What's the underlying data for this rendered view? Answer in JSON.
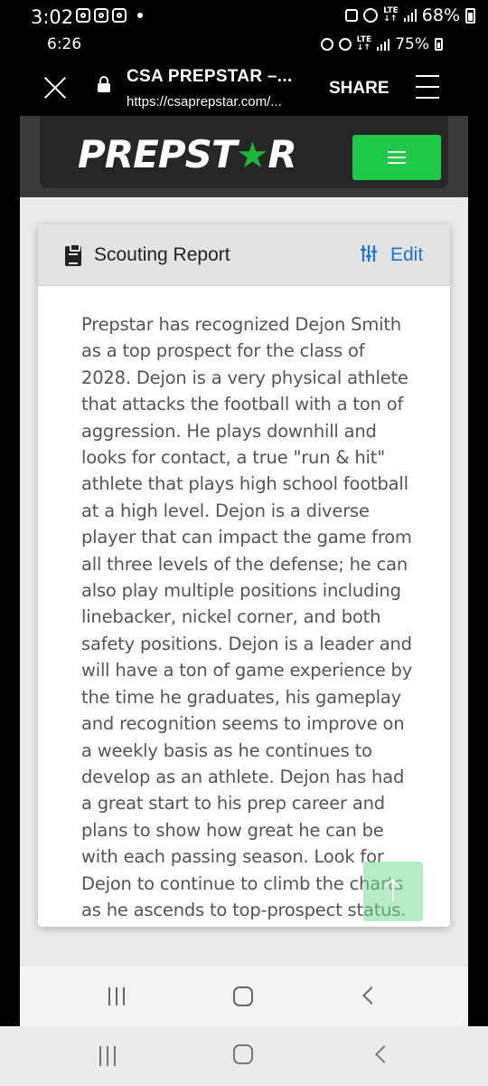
{
  "status_bar": {
    "time": "3:02",
    "battery": "68%"
  },
  "inner_status_bar": {
    "time": "6:26",
    "battery": "75%"
  },
  "browser": {
    "tab_title": "CSA PREPSTAR –...",
    "url": "https://csaprepstar.com/...",
    "share_label": "SHARE"
  },
  "site": {
    "logo_text_a": "PREPST",
    "logo_text_b": "R"
  },
  "report_card": {
    "title": "Scouting Report",
    "edit_label": "Edit",
    "body": "Prepstar has recognized Dejon Smith as a top prospect for the class of 2028. Dejon is a very physical athlete that attacks the football with a ton of aggression. He plays downhill and looks for contact, a true \"run & hit\" athlete that plays high school football at a high level. Dejon is a diverse player that can impact the game from all three levels of the defense; he can also play multiple positions including linebacker, nickel corner, and both safety positions. Dejon is a leader and will have a ton of game experience by the time he graduates, his gameplay and recognition seems to improve on a weekly basis as he continues to develop as an athlete. Dejon has had a great start to his prep career and plans to show how great he can be with each passing season. Look for Dejon to continue to climb the charts as he ascends to top-prospect status."
  },
  "colors": {
    "brand_green": "#1ec94a",
    "link_blue": "#1e73d6"
  },
  "icons": [
    "instagram-icon",
    "close-icon",
    "lock-icon",
    "menu-icon",
    "clipboard-icon",
    "sliders-icon",
    "arrow-up-icon",
    "recents-icon",
    "home-icon",
    "back-icon"
  ]
}
